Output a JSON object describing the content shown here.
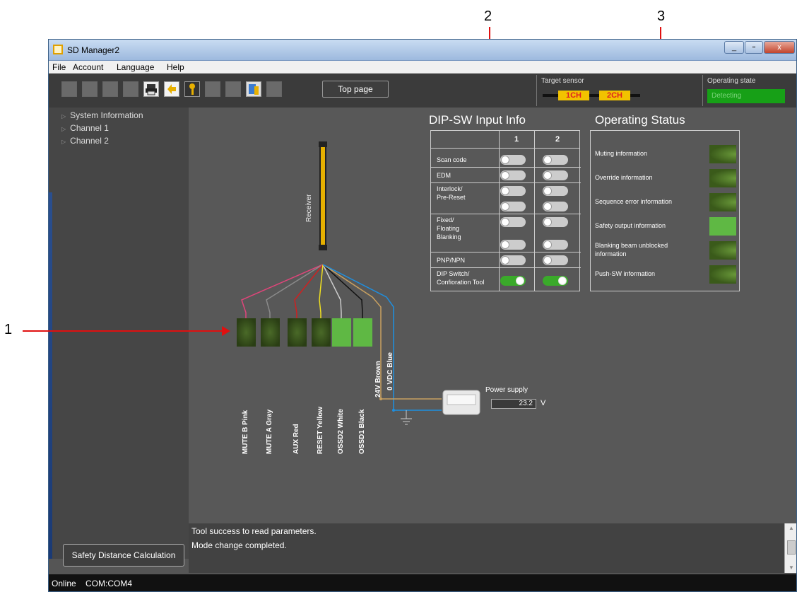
{
  "callouts": [
    "1",
    "2",
    "3"
  ],
  "window": {
    "title": "SD Manager2",
    "buttons": [
      "_",
      "▫",
      "x"
    ]
  },
  "menu": [
    "File",
    "Account",
    "Language",
    "Help"
  ],
  "toolbar": {
    "top_page_label": "Top page",
    "target_sensor_label": "Target sensor",
    "channels": [
      "1CH",
      "2CH"
    ],
    "operating_state_label": "Operating state",
    "operating_state_value": "Detecting"
  },
  "sidebar": {
    "items": [
      "System Information",
      "Channel 1",
      "Channel 2"
    ],
    "safety_button": "Safety Distance Calculation"
  },
  "dip": {
    "title": "DIP-SW Input Info",
    "columns": [
      "1",
      "2"
    ],
    "rows": [
      {
        "label": "Scan code",
        "ch1": [
          false
        ],
        "ch2": [
          false
        ]
      },
      {
        "label": "EDM",
        "ch1": [
          false
        ],
        "ch2": [
          false
        ]
      },
      {
        "label": "Interlock/\nPre-Reset",
        "ch1": [
          false,
          false
        ],
        "ch2": [
          false,
          false
        ]
      },
      {
        "label": "Fixed/\nFloating\nBlanking",
        "ch1": [
          false,
          false
        ],
        "ch2": [
          false,
          false
        ]
      },
      {
        "label": "PNP/NPN",
        "ch1": [
          false
        ],
        "ch2": [
          false
        ]
      },
      {
        "label": "DIP Switch/\nConfioration Tool",
        "ch1": [
          true
        ],
        "ch2": [
          true
        ]
      }
    ]
  },
  "status": {
    "title": "Operating Status",
    "items": [
      {
        "label": "Muting information",
        "on": false
      },
      {
        "label": "Override information",
        "on": false
      },
      {
        "label": "Sequence error information",
        "on": false
      },
      {
        "label": "Safety output information",
        "on": true
      },
      {
        "label": "Blanking beam unblocked\ninformation",
        "on": false
      },
      {
        "label": "Push-SW information",
        "on": false
      }
    ]
  },
  "wiring": {
    "receiver_label": "Receiver",
    "terminals": [
      {
        "label": "MUTE B Pink",
        "on": false,
        "color": "#e0457a"
      },
      {
        "label": "MUTE A Gray",
        "on": false,
        "color": "#8a8a8a"
      },
      {
        "label": "AUX Red",
        "on": false,
        "color": "#d02020"
      },
      {
        "label": "RESET Yellow",
        "on": false,
        "color": "#f0e020"
      },
      {
        "label": "OSSD2 White",
        "on": true,
        "color": "#cccccc"
      },
      {
        "label": "OSSD1 Black",
        "on": true,
        "color": "#111111"
      }
    ],
    "power_wires": [
      {
        "label": "24V Brown",
        "color": "#c8a060"
      },
      {
        "label": "0 VDC Blue",
        "color": "#1e8fe0"
      }
    ],
    "power_supply_label": "Power supply",
    "voltage": "23.2",
    "voltage_unit": "V"
  },
  "log": [
    "Tool success to read parameters.",
    "Mode change completed."
  ],
  "statusbar": {
    "state": "Online",
    "port": "COM:COM4"
  }
}
